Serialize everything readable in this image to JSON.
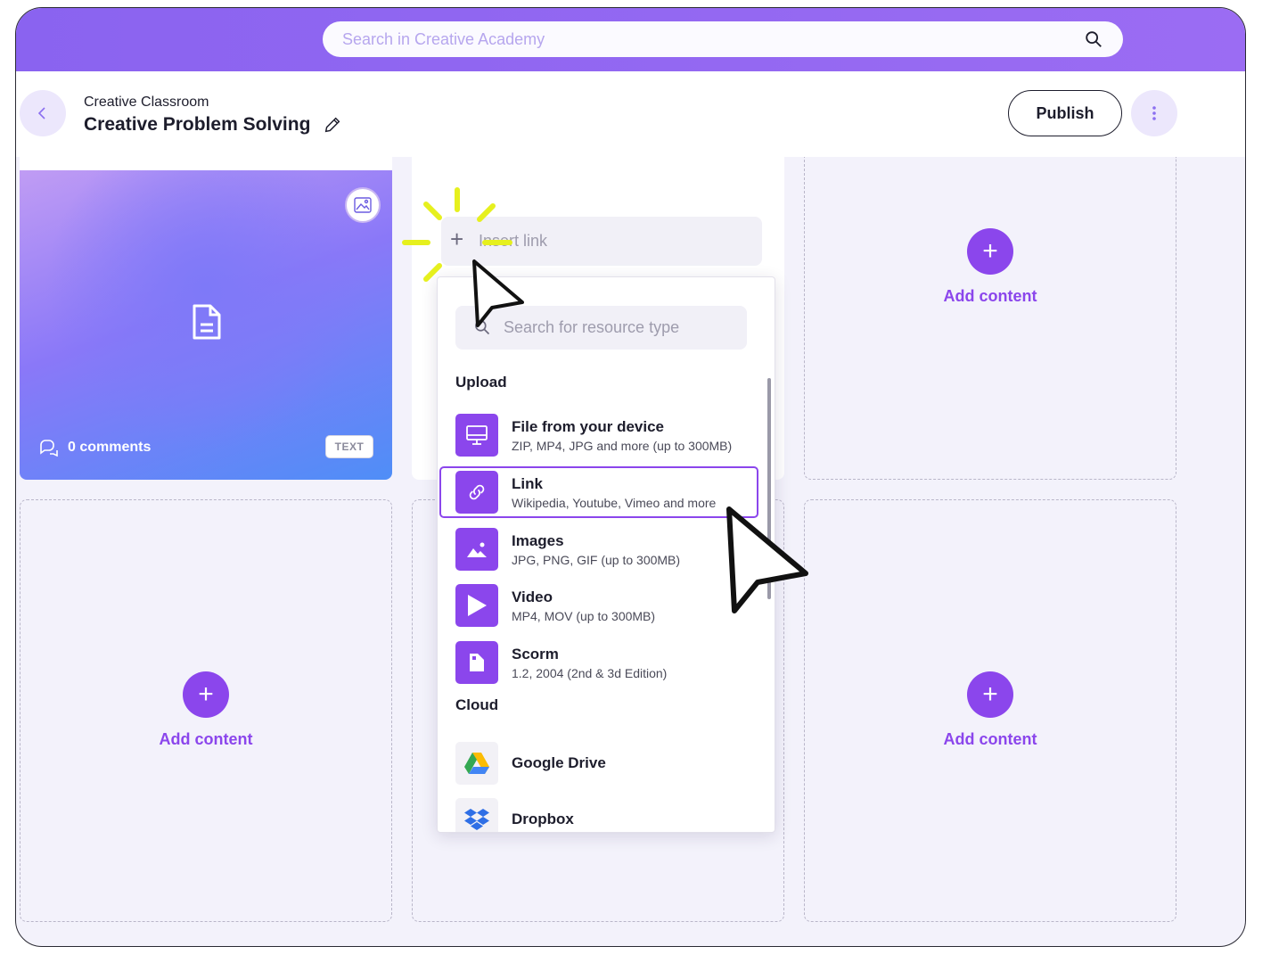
{
  "search": {
    "placeholder": "Search in Creative Academy"
  },
  "header": {
    "breadcrumb": "Creative Classroom",
    "title": "Creative Problem Solving",
    "publish_label": "Publish"
  },
  "card": {
    "comments": "0 comments",
    "badge": "TEXT"
  },
  "insert": {
    "placeholder": "Insert link"
  },
  "add_content_label": "Add content",
  "dropdown": {
    "search_placeholder": "Search for resource type",
    "upload_section": "Upload",
    "cloud_section": "Cloud",
    "upload_items": [
      {
        "title": "File from your device",
        "subtitle": "ZIP, MP4, JPG and more (up to 300MB)",
        "icon": "monitor-icon"
      },
      {
        "title": "Link",
        "subtitle": "Wikipedia, Youtube, Vimeo and more",
        "icon": "link-icon"
      },
      {
        "title": "Images",
        "subtitle": "JPG, PNG, GIF (up to 300MB)",
        "icon": "image-icon"
      },
      {
        "title": "Video",
        "subtitle": "MP4, MOV (up to 300MB)",
        "icon": "play-icon"
      },
      {
        "title": "Scorm",
        "subtitle": "1.2, 2004 (2nd & 3d Edition)",
        "icon": "scorm-icon"
      }
    ],
    "cloud_items": [
      {
        "title": "Google Drive",
        "icon": "google-drive-icon"
      },
      {
        "title": "Dropbox",
        "icon": "dropbox-icon"
      }
    ]
  },
  "colors": {
    "accent": "#8b46ec",
    "topbar": "#8a63f0",
    "highlight": "#e6f01e"
  }
}
